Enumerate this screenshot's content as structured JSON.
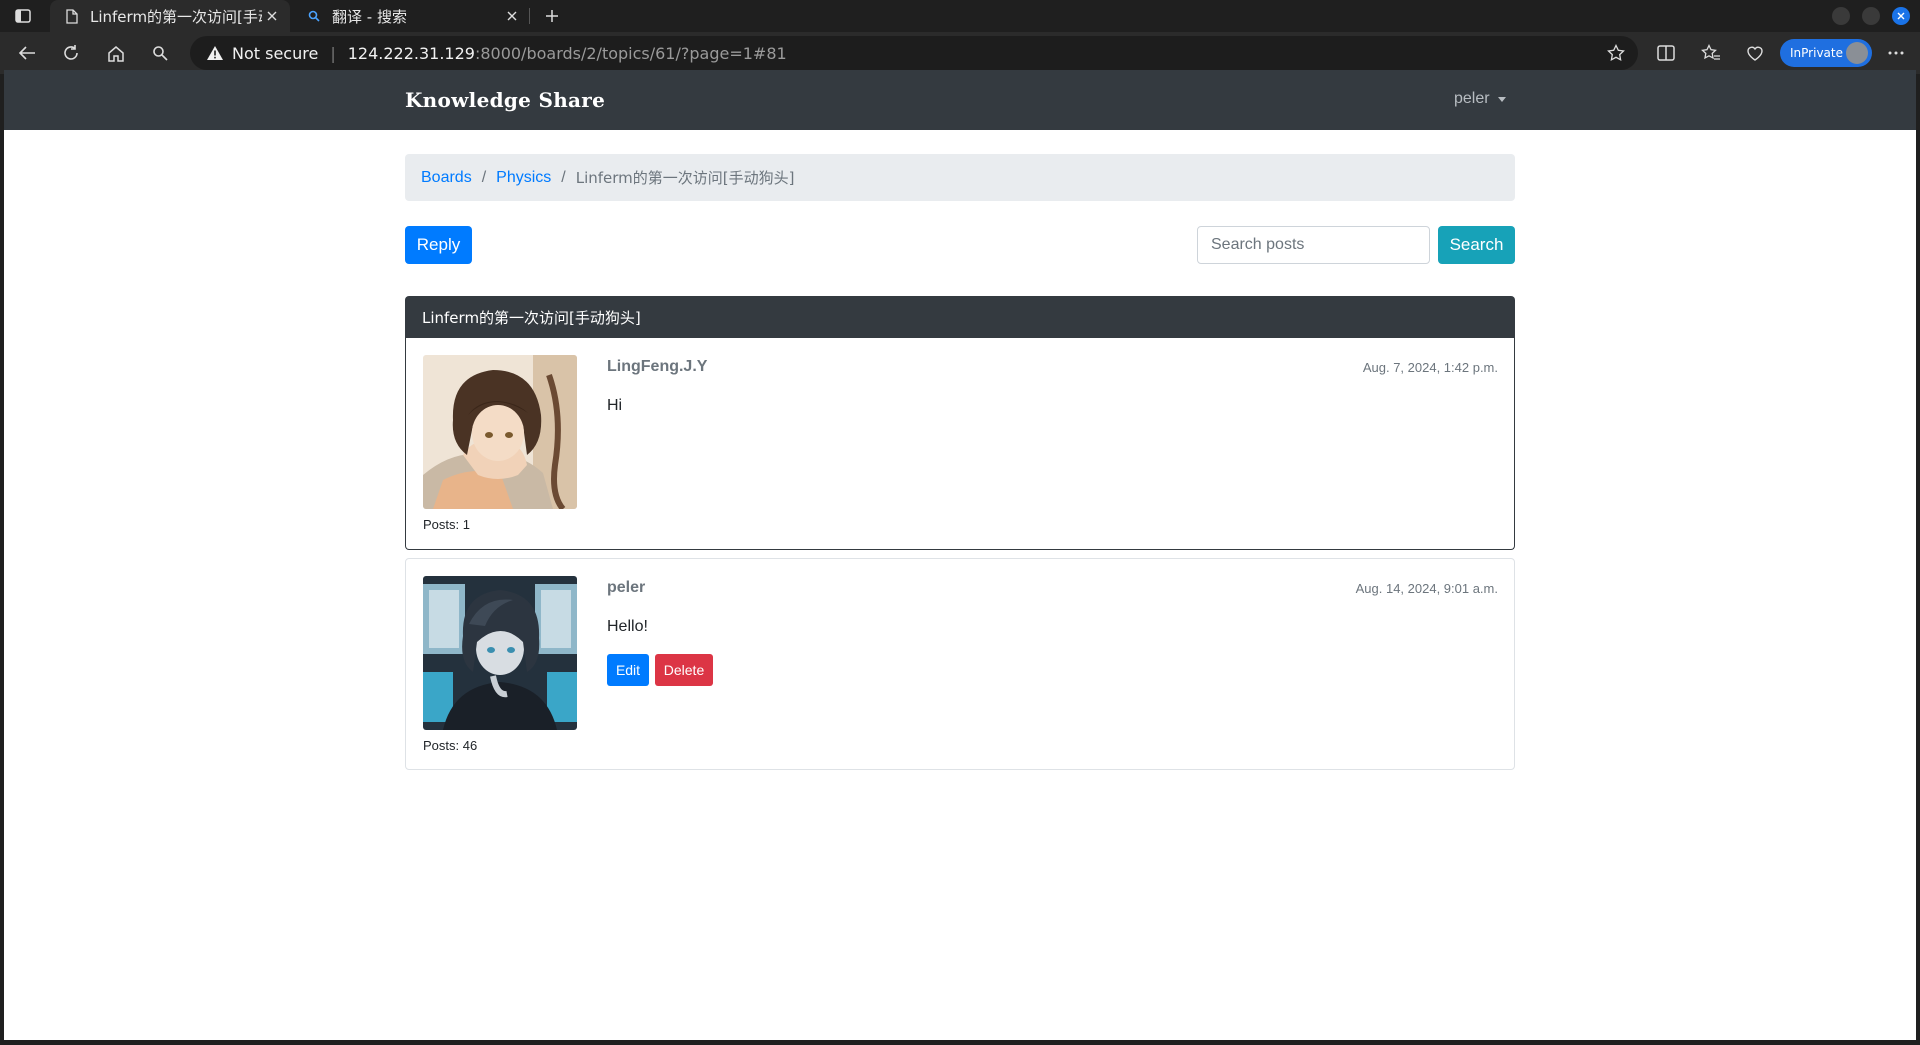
{
  "browser": {
    "tabs": [
      {
        "title": "Linferm的第一次访问[手动",
        "active": true
      },
      {
        "title": "翻译 - 搜索",
        "active": false
      }
    ],
    "address": {
      "security_label": "Not secure",
      "host": "124.222.31.129",
      "path": ":8000/boards/2/topics/61/?page=1#81"
    },
    "profile_badge": "InPrivate"
  },
  "site": {
    "brand": "Knowledge Share",
    "user": "peler"
  },
  "breadcrumb": {
    "items": [
      "Boards",
      "Physics"
    ],
    "active": "Linferm的第一次访问[手动狗头]"
  },
  "actions": {
    "reply_label": "Reply",
    "search_placeholder": "Search posts",
    "search_label": "Search"
  },
  "topic": {
    "title": "Linferm的第一次访问[手动狗头]"
  },
  "posts": [
    {
      "author": "LingFeng.J.Y",
      "date": "Aug. 7, 2024, 1:42 p.m.",
      "message": "Hi",
      "posts_count": "Posts: 1"
    },
    {
      "author": "peler",
      "date": "Aug. 14, 2024, 9:01 a.m.",
      "message": "Hello!",
      "posts_count": "Posts: 46",
      "edit_label": "Edit",
      "delete_label": "Delete"
    }
  ],
  "colors": {
    "navbar": "#343a40",
    "primary": "#007bff",
    "info": "#17a2b8",
    "danger": "#dc3545",
    "breadcrumb_bg": "#e9ecef"
  }
}
